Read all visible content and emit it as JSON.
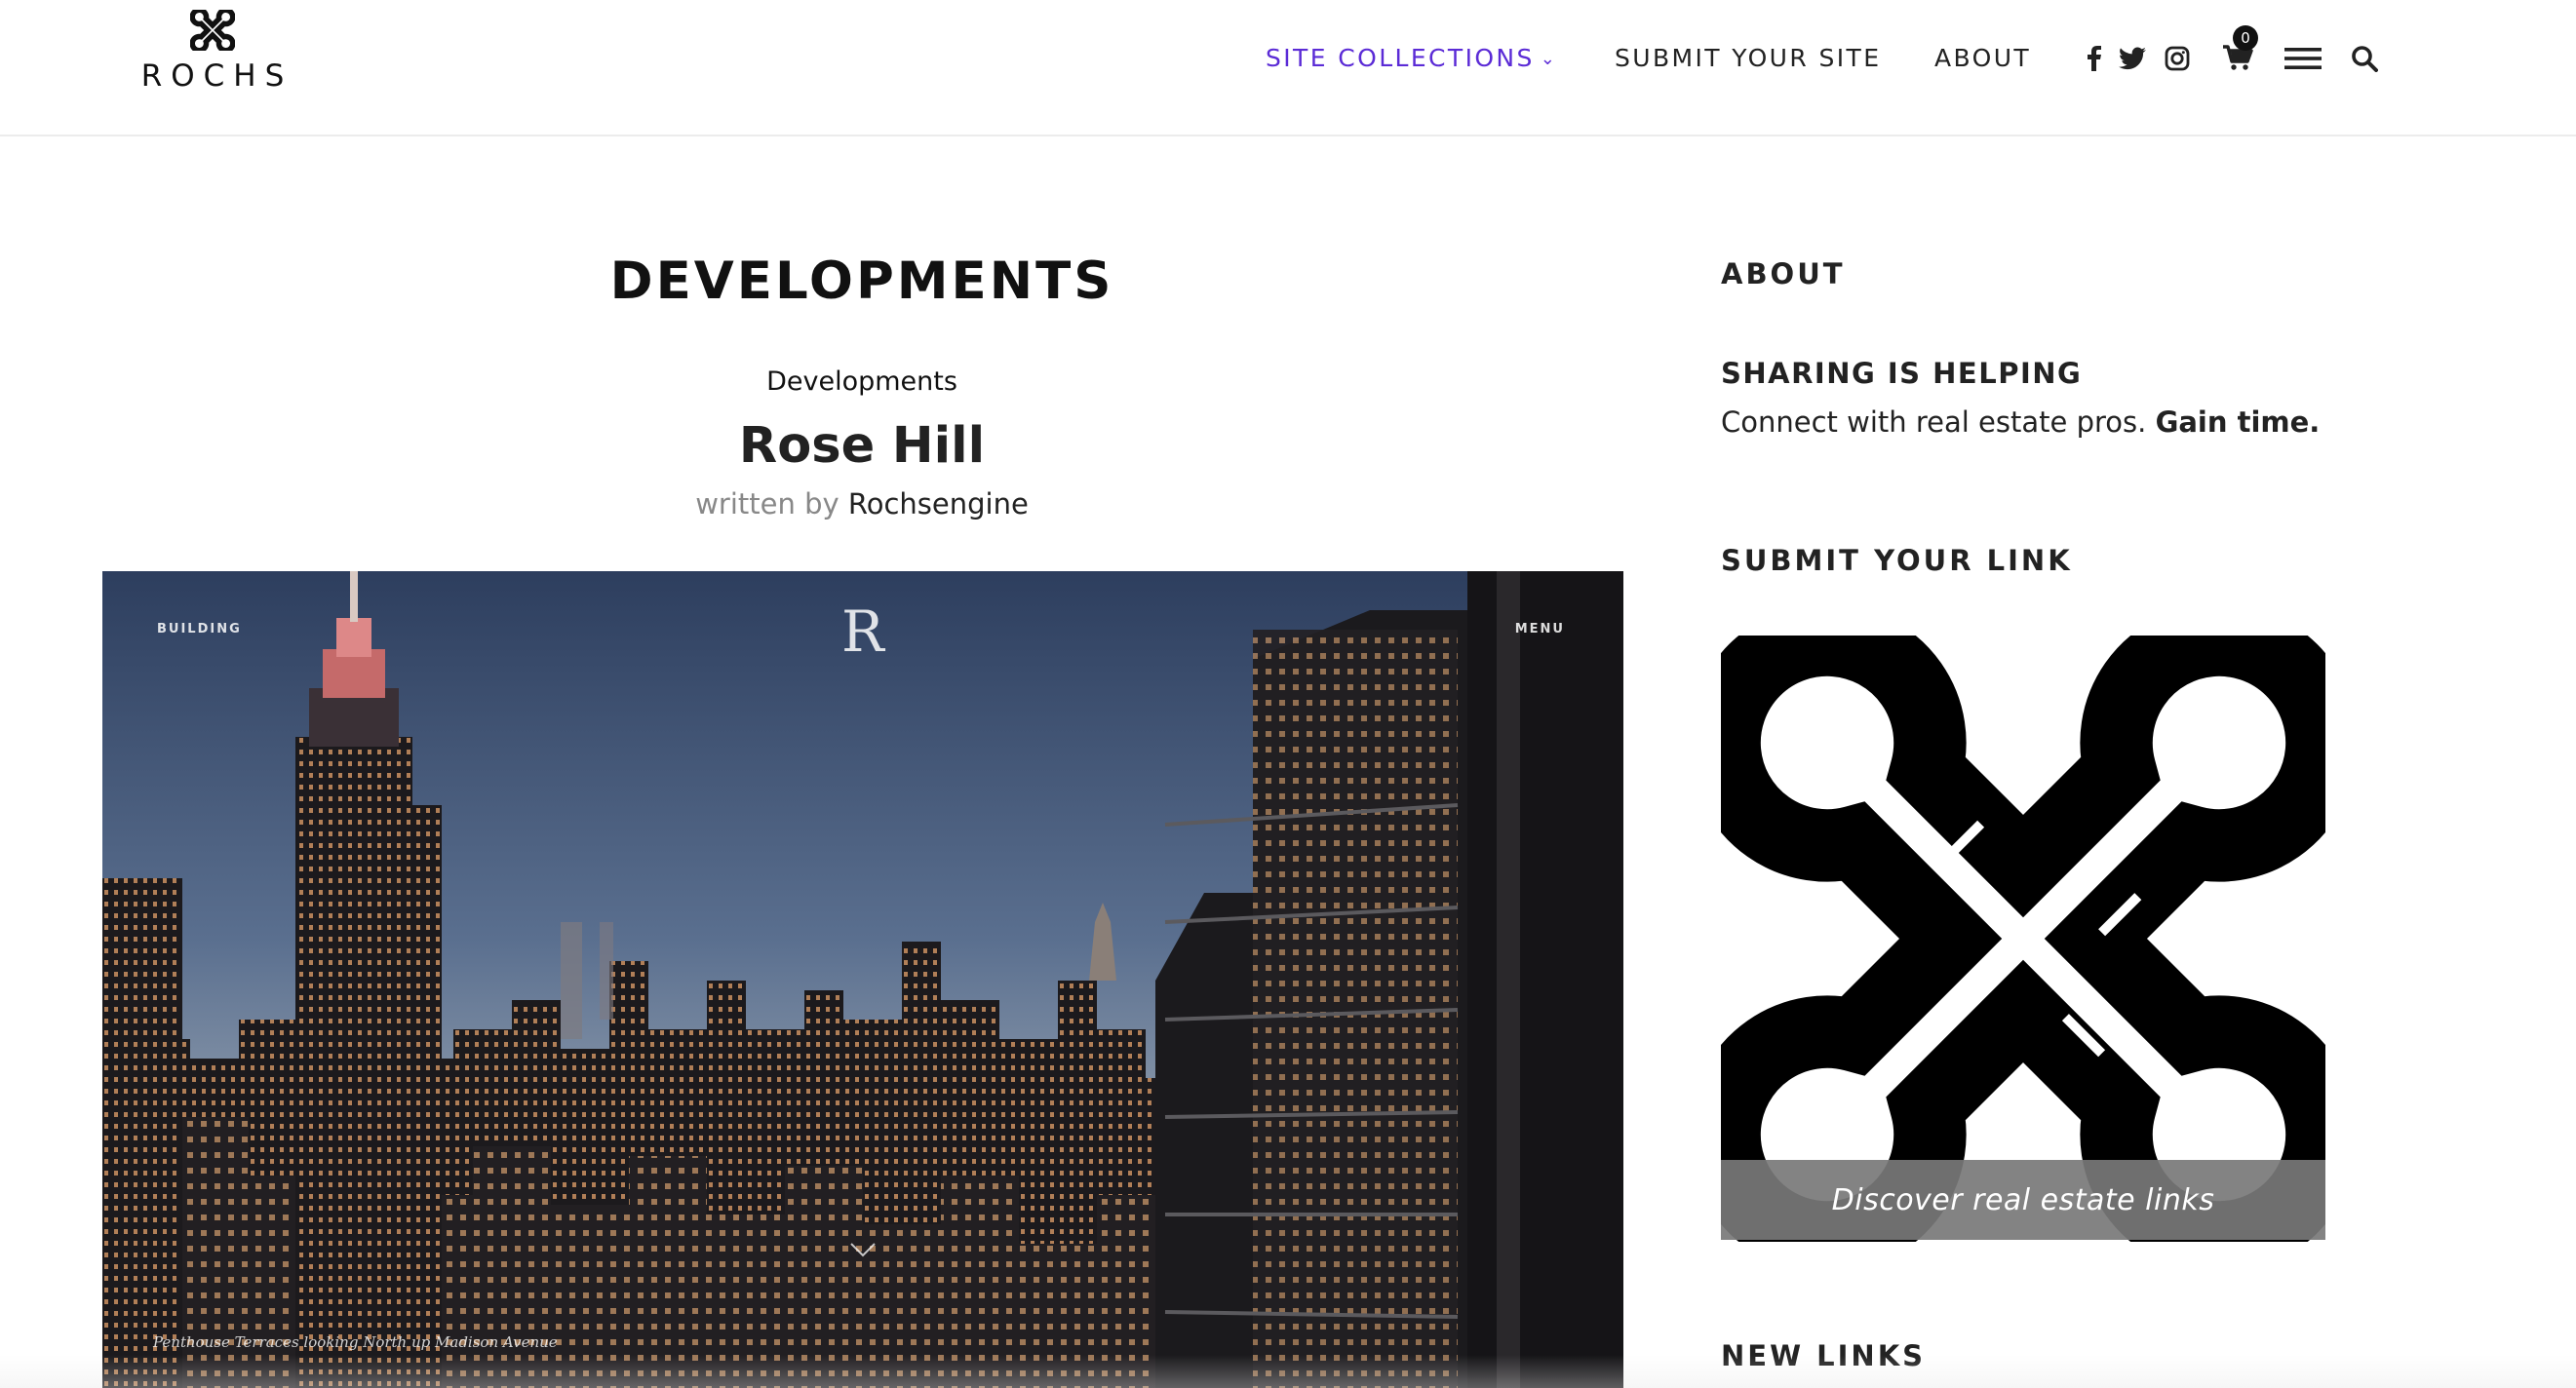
{
  "brand": {
    "name": "ROCHS",
    "logo_icon": "rochs-knot-icon"
  },
  "nav": {
    "items": [
      {
        "label": "SITE COLLECTIONS",
        "has_dropdown": true,
        "active": true
      },
      {
        "label": "SUBMIT YOUR SITE"
      },
      {
        "label": "ABOUT"
      }
    ],
    "social_icons": [
      "facebook-icon",
      "twitter-icon",
      "instagram-icon"
    ],
    "cart_count": "0",
    "accent_color": "#5b2bd6"
  },
  "main": {
    "heading": "DEVELOPMENTS",
    "category": "Developments",
    "post_title": "Rose Hill",
    "byline_prefix": "written by",
    "author": "Rochsengine",
    "hero": {
      "left_label": "BUILDING",
      "right_label": "MENU",
      "logo_letter": "R",
      "caption": "Penthouse Terraces looking North up Madison Avenue"
    }
  },
  "sidebar": {
    "about_title": "ABOUT",
    "about_strong": "SHARING IS HELPING",
    "about_text": "Connect with real estate pros.",
    "about_text_bold": "Gain time.",
    "submit_title": "SUBMIT YOUR LINK",
    "promo_caption": "Discover real estate links",
    "new_links_title": "NEW LINKS"
  }
}
